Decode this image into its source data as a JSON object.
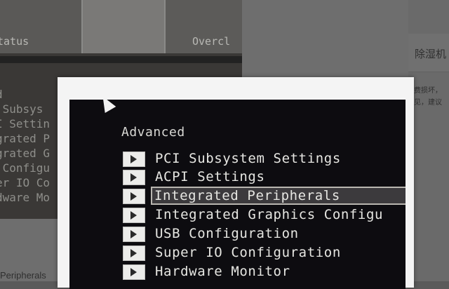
{
  "background": {
    "tabs": [
      {
        "label": "tatus"
      },
      {
        "label": ""
      },
      {
        "label": "Overcl"
      }
    ],
    "lines": [
      "d",
      " Subsys",
      "I Settin",
      "grated P",
      "grated G",
      " Configu",
      "er IO Co",
      "dware Mo"
    ],
    "right_title": "除湿机",
    "right_text": [
      "费损坏，",
      "见，建议"
    ],
    "bottom_text": "Peripherals"
  },
  "bios": {
    "title": "Advanced",
    "items": [
      {
        "label": "PCI Subsystem Settings"
      },
      {
        "label": "ACPI Settings"
      },
      {
        "label": "Integrated Peripherals",
        "selected": true
      },
      {
        "label": "Integrated Graphics Configu"
      },
      {
        "label": "USB Configuration"
      },
      {
        "label": "Super IO Configuration"
      },
      {
        "label": "Hardware Monitor"
      }
    ]
  },
  "icons": {
    "menu_arrow": "play-arrow-icon",
    "pointer": "mouse-cursor-icon"
  },
  "colors": {
    "bios_background": "#0d0c10",
    "bios_text": "#e6e6e2",
    "selection_outline": "#b9b6b0"
  }
}
